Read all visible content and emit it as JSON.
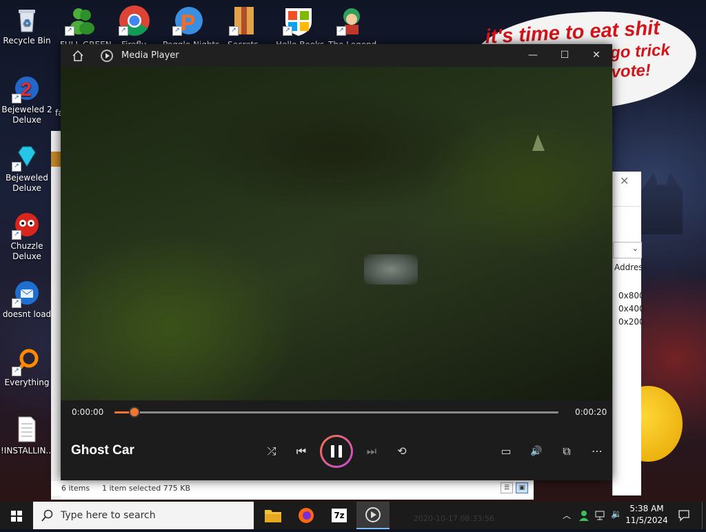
{
  "desktop": {
    "bubble": {
      "line1": "it's time to eat shit",
      "line2": "go trick",
      "line3": "vote!"
    },
    "left_icons": [
      {
        "label": "Recycle Bin"
      },
      {
        "label": "Bejeweled 2 Deluxe"
      },
      {
        "label": "Bejeweled Deluxe"
      },
      {
        "label": "Chuzzle Deluxe"
      },
      {
        "label": "doesnt load"
      },
      {
        "label": "Everything"
      },
      {
        "label": "!INSTALLIN..."
      }
    ],
    "partial_label": "fa",
    "top_labels": [
      "FULL GREEN",
      "Firefly",
      "Peggle Nights",
      "Secrets",
      "Hello Books",
      "The Legend"
    ]
  },
  "background_window": {
    "status_items": "6 items",
    "status_selected": "1 item selected  775 KB",
    "column_header": "Address",
    "addresses": [
      "0x800",
      "0x400",
      "0x200"
    ],
    "close_glyph": "✕",
    "dropdown_glyph": "⌄"
  },
  "player": {
    "window_title": "Media Player",
    "track_title": "Ghost Car",
    "current_time": "0:00:00",
    "total_time": "0:00:20",
    "progress": 0.045,
    "buttons": {
      "minimize": "—",
      "maximize": "☐",
      "close": "✕",
      "shuffle": "⤮",
      "previous": "⏮",
      "next": "⏭",
      "repeat": "⟲",
      "captions": "▭",
      "volume": "🔊",
      "miniplayer": "⧉",
      "more": "⋯"
    }
  },
  "taskbar": {
    "search_placeholder": "Type here to search",
    "ghost_text": "2020-10-17 08:33:56",
    "time": "5:38 AM",
    "date": "11/5/2024",
    "apps": [
      "file-explorer",
      "firefox",
      "7zip",
      "media-player"
    ],
    "seven_zip_label": "7z"
  },
  "colors": {
    "accent_orange": "#f27630",
    "bubble_text": "#d4141a"
  }
}
